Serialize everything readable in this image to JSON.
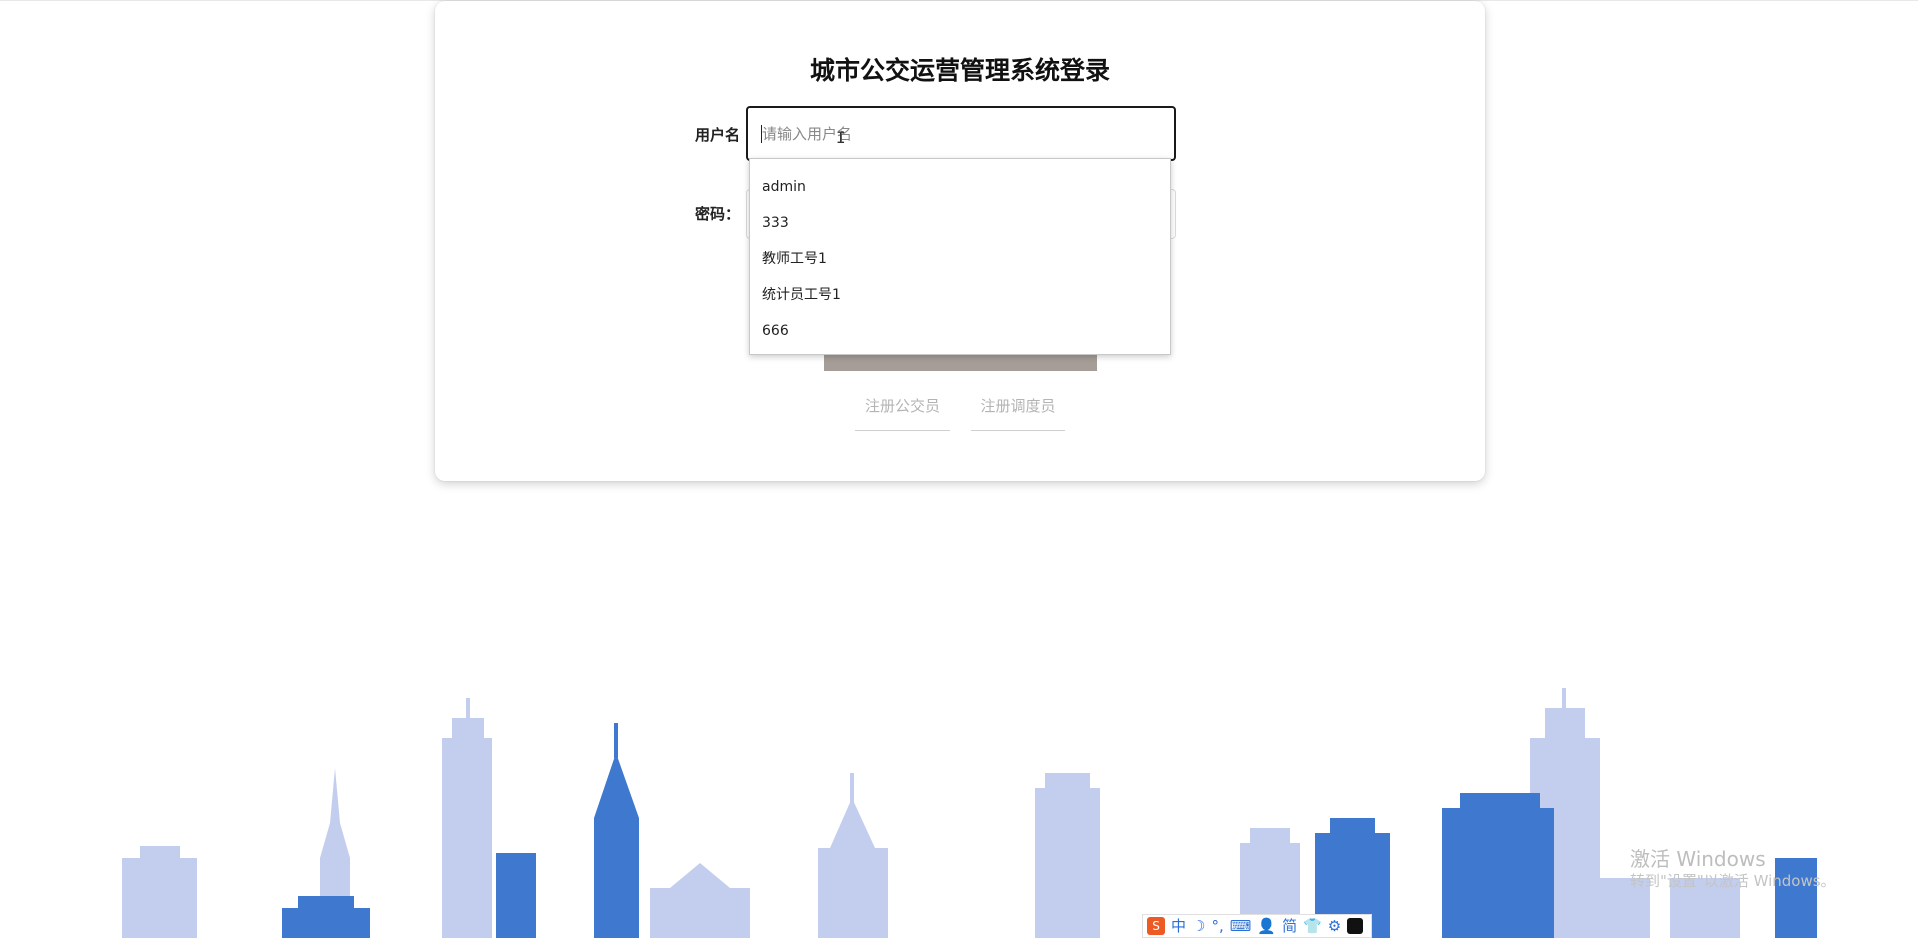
{
  "login": {
    "title": "城市公交运营管理系统登录",
    "username_label": "用户名",
    "username_placeholder": "请输入用户名",
    "password_label": "密码：",
    "register_bus_driver": "注册公交员",
    "register_dispatcher": "注册调度员"
  },
  "autocomplete": {
    "items": [
      "admin",
      "333",
      "教师工号1",
      "统计员工号1",
      "666"
    ]
  },
  "watermark": {
    "line1": "激活 Windows",
    "line2": "转到\"设置\"以激活 Windows。"
  },
  "ime_toolbar": {
    "logo": "S",
    "mode": "中",
    "moon": "☽",
    "punct": "°,",
    "keyboard": "⌨",
    "user": "👤",
    "simplified": "简",
    "skin": "👕",
    "settings": "⚙"
  },
  "colors": {
    "login_button": "#a69d98",
    "skyline_light": "#c3ceef",
    "skyline_dark": "#3f79cf"
  }
}
